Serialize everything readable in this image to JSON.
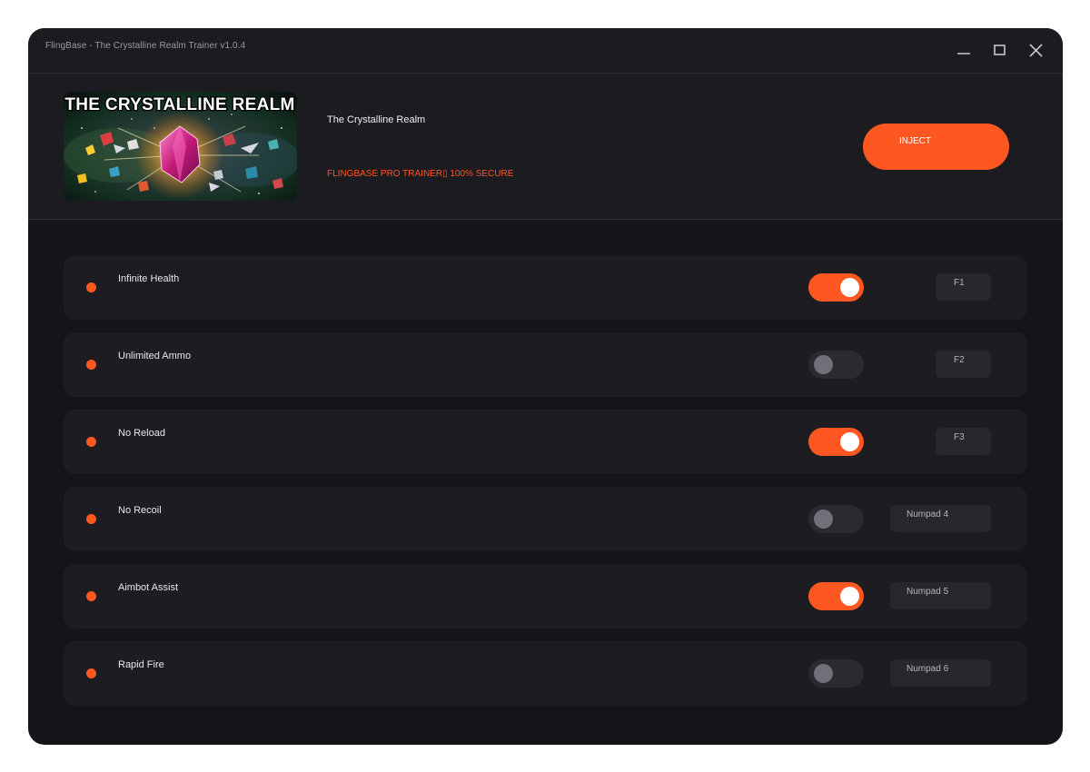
{
  "window": {
    "title": "FlingBase - The Crystalline Realm Trainer v1.0.4"
  },
  "header": {
    "cover_text": "THE CRYSTALLINE REALM",
    "game_name": "The Crystalline Realm",
    "tagline": "FLINGBASE PRO TRAINER▯ 100% SECURE",
    "inject_label": "INJECT"
  },
  "colors": {
    "accent": "#ff5722",
    "background": "#141419",
    "panel": "#1b1b20",
    "row": "#1c1c21"
  },
  "cheats": [
    {
      "name": "Infinite Health",
      "enabled": true,
      "hotkey": "F1"
    },
    {
      "name": "Unlimited Ammo",
      "enabled": false,
      "hotkey": "F2"
    },
    {
      "name": "No Reload",
      "enabled": true,
      "hotkey": "F3"
    },
    {
      "name": "No Recoil",
      "enabled": false,
      "hotkey": "Numpad 4"
    },
    {
      "name": "Aimbot Assist",
      "enabled": true,
      "hotkey": "Numpad 5"
    },
    {
      "name": "Rapid Fire",
      "enabled": false,
      "hotkey": "Numpad 6"
    }
  ]
}
